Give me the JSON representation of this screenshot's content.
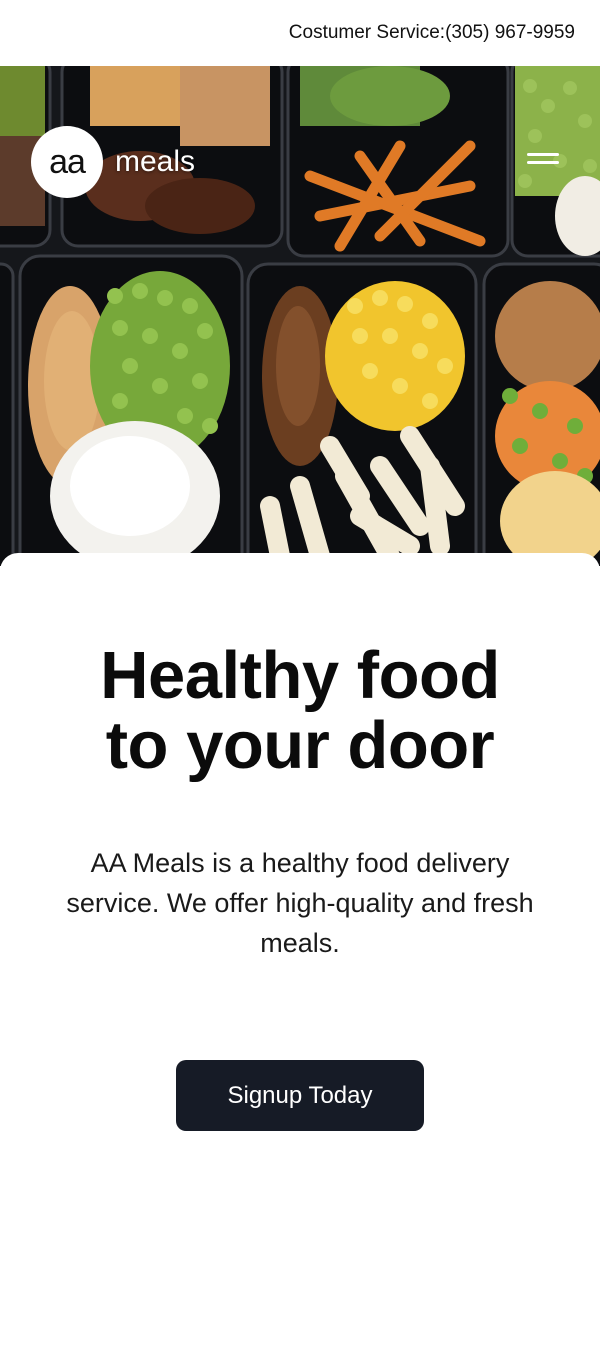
{
  "topbar": {
    "service_label": "Costumer Service:",
    "phone": "(305) 967-9959"
  },
  "brand": {
    "logo_text": "aa",
    "name": "meals"
  },
  "hero": {
    "headline_line1": "Healthy food",
    "headline_line2": "to your door",
    "description": "AA Meals is a healthy food delivery service. We offer high-quality and fresh meals.",
    "cta_label": "Signup Today"
  },
  "colors": {
    "cta_background": "#161b26",
    "text": "#0b0b0b",
    "background": "#ffffff"
  }
}
